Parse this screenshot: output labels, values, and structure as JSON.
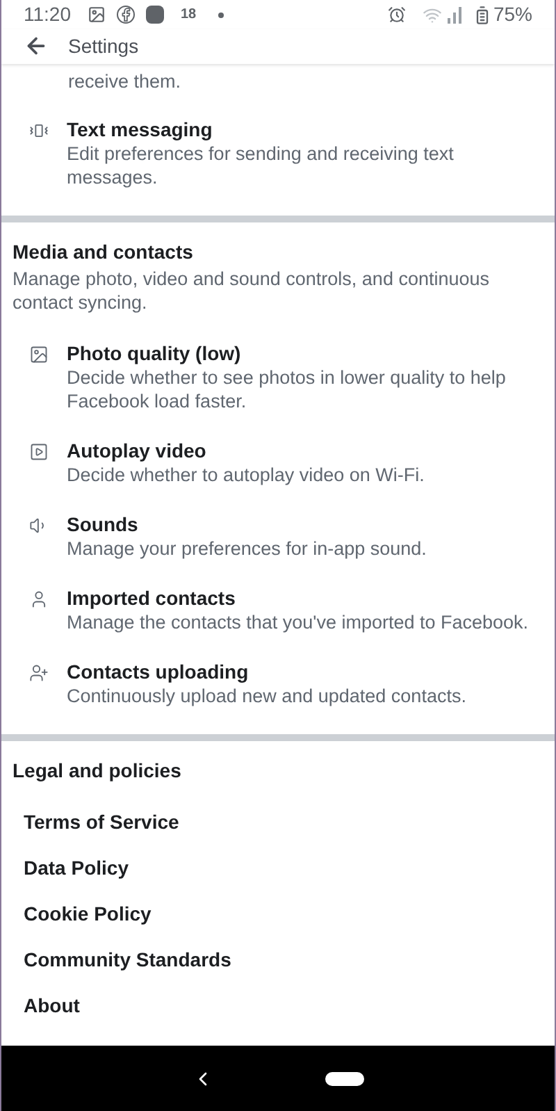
{
  "status_bar": {
    "time": "11:20",
    "notification_count": "18",
    "battery": "75%"
  },
  "header": {
    "title": "Settings"
  },
  "partial_text": "receive them.",
  "top_items": [
    {
      "title": "Text messaging",
      "description": "Edit preferences for sending and receiving text messages."
    }
  ],
  "media_section": {
    "title": "Media and contacts",
    "description": "Manage photo, video and sound controls, and continuous contact syncing.",
    "items": [
      {
        "title": "Photo quality (low)",
        "description": "Decide whether to see photos in lower quality to help Facebook load faster."
      },
      {
        "title": "Autoplay video",
        "description": "Decide whether to autoplay video on Wi-Fi."
      },
      {
        "title": "Sounds",
        "description": "Manage your preferences for in-app sound."
      },
      {
        "title": "Imported contacts",
        "description": "Manage the contacts that you've imported to Facebook."
      },
      {
        "title": "Contacts uploading",
        "description": "Continuously upload new and updated contacts."
      }
    ]
  },
  "legal_section": {
    "title": "Legal and policies",
    "links": [
      "Terms of Service",
      "Data Policy",
      "Cookie Policy",
      "Community Standards",
      "About"
    ]
  }
}
